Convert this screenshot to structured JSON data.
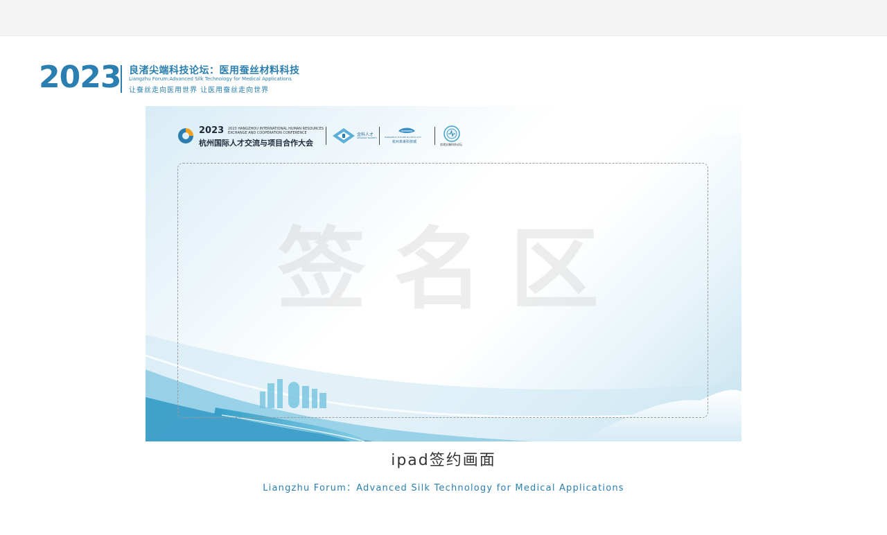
{
  "brand": {
    "year": "2023",
    "title_cn": "良渚尖端科技论坛：医用蚕丝材料科技",
    "title_en": "Liangzhu Forum:Advanced Silk Technology for Medical Applications",
    "slogan": "让蚕丝走向医用世界   让医用蚕丝走向世界",
    "color": "#2a7fb0"
  },
  "canvas": {
    "event_year": "2023",
    "event_en_line1": "2023 HANGZHOU INTERNATIONAL HUMAN RESOURCES",
    "event_en_line2": "EXCHANGE AND COOPERATION CONFERENCE",
    "event_cn": "杭州国际人才交流与项目合作大会",
    "partners": [
      {
        "name": "金科人才",
        "sub": "ADVANCE TALENTS"
      },
      {
        "name": "杭州未来科技城",
        "sub": "HANGZHOU FUTURE SCI-TECH CITY"
      },
      {
        "name": "良渚尖端科技论坛",
        "sub": ""
      }
    ],
    "sign_watermark": "签名区"
  },
  "caption": "ipad签约画面",
  "footer_en": "Liangzhu Forum：Advanced Silk Technology for Medical Applications"
}
